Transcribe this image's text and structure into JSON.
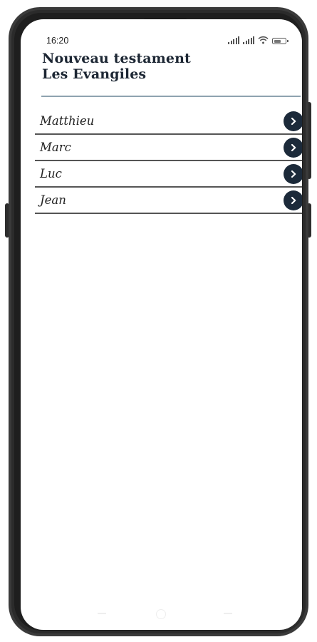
{
  "status_bar": {
    "time": "16:20"
  },
  "header": {
    "line1": "Nouveau testament",
    "line2": "Les Evangiles"
  },
  "books": [
    {
      "label": "Matthieu"
    },
    {
      "label": "Marc"
    },
    {
      "label": "Luc"
    },
    {
      "label": "Jean"
    }
  ],
  "colors": {
    "accent": "#1c2a3a",
    "title": "#1c2633",
    "rule": "#8fa3b0"
  },
  "icons": {
    "item_action": "chevron-right-icon",
    "status": [
      "signal-icon",
      "wifi-icon",
      "battery-icon"
    ]
  }
}
